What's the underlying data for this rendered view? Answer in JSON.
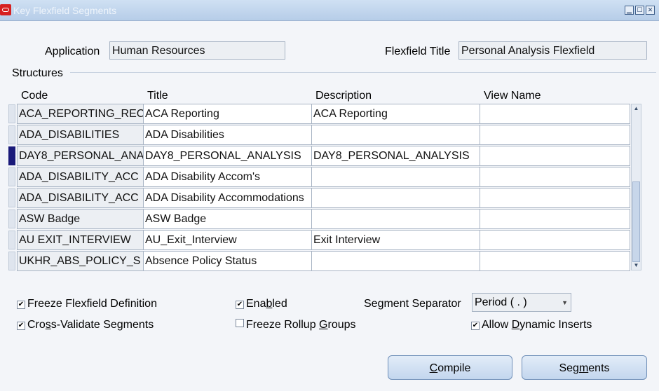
{
  "window": {
    "title": "Key Flexfield Segments"
  },
  "form": {
    "application_label": "Application",
    "application_value": "Human Resources",
    "flexfield_title_label": "Flexfield Title",
    "flexfield_title_value": "Personal Analysis Flexfield"
  },
  "structures": {
    "label": "Structures",
    "columns": [
      "Code",
      "Title",
      "Description",
      "View Name"
    ],
    "rows": [
      {
        "code": "ACA_REPORTING_REC",
        "title": "ACA Reporting",
        "description": "ACA Reporting",
        "view": ""
      },
      {
        "code": "ADA_DISABILITIES",
        "title": "ADA Disabilities",
        "description": "",
        "view": ""
      },
      {
        "code": "DAY8_PERSONAL_ANA",
        "title": "DAY8_PERSONAL_ANALYSIS",
        "description": "DAY8_PERSONAL_ANALYSIS",
        "view": ""
      },
      {
        "code": "ADA_DISABILITY_ACC",
        "title": "ADA Disability Accom's",
        "description": "",
        "view": ""
      },
      {
        "code": "ADA_DISABILITY_ACC",
        "title": "ADA Disability Accommodations",
        "description": "",
        "view": ""
      },
      {
        "code": "ASW Badge",
        "title": "ASW Badge",
        "description": "",
        "view": ""
      },
      {
        "code": "AU EXIT_INTERVIEW",
        "title": "AU_Exit_Interview",
        "description": "Exit Interview",
        "view": ""
      },
      {
        "code": "UKHR_ABS_POLICY_S",
        "title": "Absence Policy Status",
        "description": "",
        "view": ""
      }
    ]
  },
  "options": {
    "freeze_flexfield": {
      "label": "Freeze Flexfield Definition",
      "checked": true
    },
    "enabled": {
      "label_pre": "Ena",
      "label_u": "b",
      "label_post": "led",
      "checked": true
    },
    "cross_validate": {
      "label_pre": "Cro",
      "label_u": "s",
      "label_post": "s-Validate Segments",
      "checked": true
    },
    "freeze_rollup": {
      "label_pre": "Freeze Rollup ",
      "label_u": "G",
      "label_post": "roups",
      "checked": false
    },
    "segment_separator_label": "Segment Separator",
    "segment_separator_value": "Period ( . )",
    "allow_dynamic": {
      "label_pre": "Allow ",
      "label_u": "D",
      "label_post": "ynamic Inserts",
      "checked": true
    }
  },
  "buttons": {
    "compile_u": "C",
    "compile_rest": "ompile",
    "segments_pre": "Seg",
    "segments_u": "m",
    "segments_post": "ents"
  },
  "icons": {
    "check": "✔",
    "minimize": "▁",
    "maximize": "☐",
    "close": "✕",
    "scroll_up": "▲",
    "scroll_down": "▼",
    "dropdown": "▼"
  }
}
